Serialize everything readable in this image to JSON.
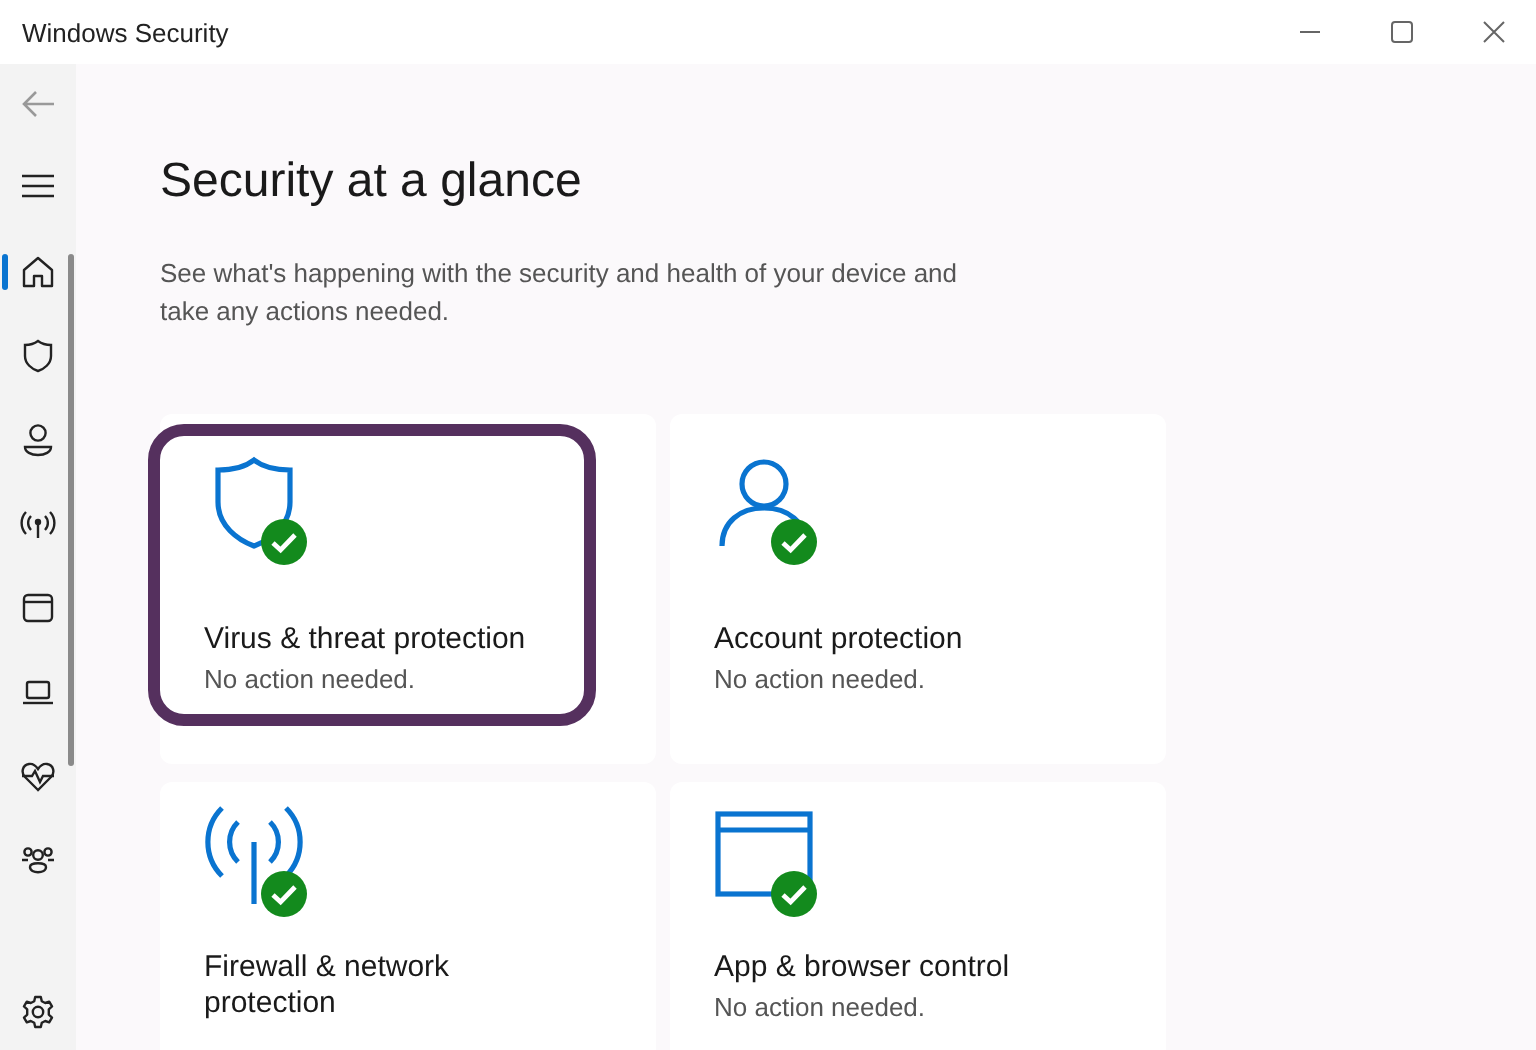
{
  "window": {
    "title": "Windows Security"
  },
  "sidebar": {
    "items": [
      {
        "selected": true
      },
      {
        "selected": false
      },
      {
        "selected": false
      },
      {
        "selected": false
      },
      {
        "selected": false
      },
      {
        "selected": false
      },
      {
        "selected": false
      },
      {
        "selected": false
      }
    ]
  },
  "page": {
    "heading": "Security at a glance",
    "description": "See what's happening with the security and health of your device and take any actions needed."
  },
  "cards": [
    {
      "title": "Virus & threat protection",
      "status": "No action needed.",
      "ok": true,
      "highlighted": true
    },
    {
      "title": "Account protection",
      "status": "No action needed.",
      "ok": true,
      "highlighted": false
    },
    {
      "title": "Firewall & network protection",
      "ok": true,
      "highlighted": false
    },
    {
      "title": "App & browser control",
      "status": "No action needed.",
      "ok": true,
      "highlighted": false
    }
  ]
}
